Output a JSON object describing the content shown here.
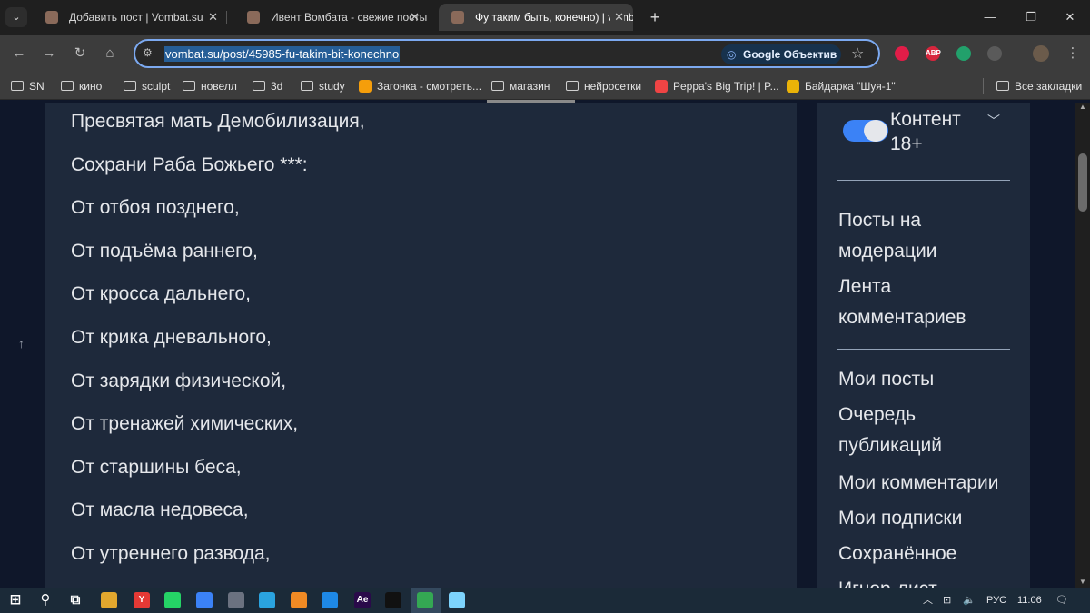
{
  "browser": {
    "tabs": [
      {
        "title": "Добавить пост | Vombat.su",
        "active": false
      },
      {
        "title": "Ивент Вомбата - свежие посты",
        "active": false
      },
      {
        "title": "Фу таким быть, конечно) | vombat",
        "active": true
      }
    ],
    "address": {
      "url": "vombat.su/post/45985-fu-takim-bit-konechno",
      "lens_label": "Google Объектив"
    },
    "extensions": [
      {
        "name": "record-extension-icon",
        "color": "#e11d48",
        "label": ""
      },
      {
        "name": "adblock-icon",
        "color": "#d7263d",
        "label": "ABP"
      },
      {
        "name": "colorful-extension-icon",
        "color": "#22a06b",
        "label": ""
      },
      {
        "name": "puzzle-icon",
        "color": "#5a5a5a",
        "label": ""
      }
    ],
    "bookmarks": [
      {
        "label": "SN",
        "kind": "folder"
      },
      {
        "label": "кино",
        "kind": "folder"
      },
      {
        "label": "sculpt",
        "kind": "folder"
      },
      {
        "label": "новелл",
        "kind": "folder"
      },
      {
        "label": "3d",
        "kind": "folder"
      },
      {
        "label": "study",
        "kind": "folder"
      },
      {
        "label": "Загонка - смотреть...",
        "kind": "site",
        "color": "#f59e0b"
      },
      {
        "label": "магазин",
        "kind": "folder"
      },
      {
        "label": "нейросетки",
        "kind": "folder"
      },
      {
        "label": "Peppa's Big Trip! | P...",
        "kind": "site",
        "color": "#ef4444"
      },
      {
        "label": "Байдарка \"Шуя-1\"",
        "kind": "site",
        "color": "#eab308"
      }
    ],
    "all_bookmarks_label": "Все закладки"
  },
  "article": {
    "lines": [
      "Пресвятая мать Демобилизация,",
      "Сохрани Раба Божьего ***:",
      "От отбоя позднего,",
      "От подъёма раннего,",
      "От кросса дальнего,",
      "От крика дневального,",
      "От зарядки физической,",
      "От тренажей химических,",
      "От старшины беса,",
      "От масла недовеса,",
      "От утреннего развода,"
    ]
  },
  "sidebar": {
    "content_toggle_label": "Контент 18+",
    "content_toggle_on": true,
    "group1": [
      "Посты на модерации",
      "Лента комментариев"
    ],
    "group2": [
      "Мои посты",
      "Очередь публикаций",
      "Мои комментарии",
      "Мои подписки",
      "Сохранённое",
      "Игнор-лист"
    ]
  },
  "taskbar": {
    "icons": [
      {
        "name": "windows-start-icon",
        "color": "#1b2a38",
        "label": ""
      },
      {
        "name": "search-icon",
        "color": "#1b2a38",
        "label": ""
      },
      {
        "name": "task-view-icon",
        "color": "#1b2a38",
        "label": ""
      },
      {
        "name": "file-explorer-icon",
        "color": "#e2a72e",
        "label": ""
      },
      {
        "name": "yandex-browser-icon",
        "color": "#e53935",
        "label": "Y"
      },
      {
        "name": "whatsapp-icon",
        "color": "#25d366",
        "label": ""
      },
      {
        "name": "chromium-icon",
        "color": "#3b82f6",
        "label": ""
      },
      {
        "name": "calculator-icon",
        "color": "#6b7280",
        "label": ""
      },
      {
        "name": "telegram-icon",
        "color": "#2aa3df",
        "label": ""
      },
      {
        "name": "blender-icon",
        "color": "#f08a24",
        "label": ""
      },
      {
        "name": "app-icon",
        "color": "#1e88e5",
        "label": ""
      },
      {
        "name": "after-effects-icon",
        "color": "#2a0a4a",
        "label": "Ae"
      },
      {
        "name": "figma-icon",
        "color": "#111111",
        "label": ""
      },
      {
        "name": "chrome-icon",
        "color": "#34a853",
        "label": ""
      },
      {
        "name": "notepad-icon",
        "color": "#7dd3fc",
        "label": ""
      }
    ],
    "language": "РУС",
    "time": "11:06"
  }
}
